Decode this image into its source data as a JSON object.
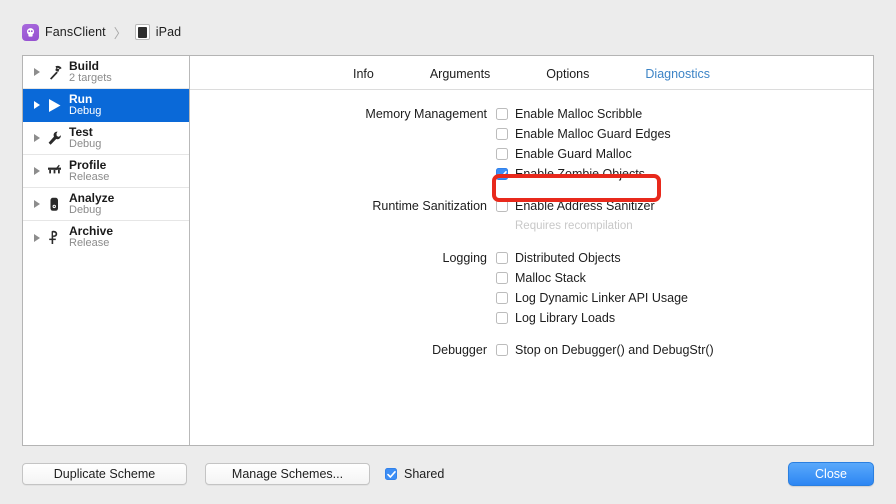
{
  "breadcrumb": {
    "app_icon": "app-icon",
    "app_name": "FansClient",
    "separator": "〉",
    "device_icon": "ipad-device-icon",
    "device_name": "iPad"
  },
  "sidebar": {
    "items": [
      {
        "title": "Build",
        "subtitle": "2 targets",
        "icon": "hammer-icon",
        "selected": false
      },
      {
        "title": "Run",
        "subtitle": "Debug",
        "icon": "play-icon",
        "selected": true
      },
      {
        "title": "Test",
        "subtitle": "Debug",
        "icon": "wrench-icon",
        "selected": false
      },
      {
        "title": "Profile",
        "subtitle": "Release",
        "icon": "gauge-icon",
        "selected": false
      },
      {
        "title": "Analyze",
        "subtitle": "Debug",
        "icon": "microscope-icon",
        "selected": false
      },
      {
        "title": "Archive",
        "subtitle": "Release",
        "icon": "archive-icon",
        "selected": false
      }
    ]
  },
  "tabs": [
    {
      "label": "Info",
      "active": false
    },
    {
      "label": "Arguments",
      "active": false
    },
    {
      "label": "Options",
      "active": false
    },
    {
      "label": "Diagnostics",
      "active": true
    }
  ],
  "diagnostics": {
    "memory_management": {
      "label": "Memory Management",
      "options": [
        {
          "label": "Enable Malloc Scribble",
          "checked": false
        },
        {
          "label": "Enable Malloc Guard Edges",
          "checked": false
        },
        {
          "label": "Enable Guard Malloc",
          "checked": false
        },
        {
          "label": "Enable Zombie Objects",
          "checked": true
        }
      ]
    },
    "runtime_sanitization": {
      "label": "Runtime Sanitization",
      "options": [
        {
          "label": "Enable Address Sanitizer",
          "checked": false
        }
      ],
      "hint": "Requires recompilation"
    },
    "logging": {
      "label": "Logging",
      "options": [
        {
          "label": "Distributed Objects",
          "checked": false
        },
        {
          "label": "Malloc Stack",
          "checked": false
        },
        {
          "label": "Log Dynamic Linker API Usage",
          "checked": false
        },
        {
          "label": "Log Library Loads",
          "checked": false
        }
      ]
    },
    "debugger": {
      "label": "Debugger",
      "options": [
        {
          "label": "Stop on Debugger() and DebugStr()",
          "checked": false
        }
      ]
    }
  },
  "footer": {
    "duplicate_scheme": "Duplicate Scheme",
    "manage_schemes": "Manage Schemes...",
    "shared_label": "Shared",
    "shared_checked": true,
    "close": "Close"
  },
  "colors": {
    "selection_blue": "#0a69d8",
    "accent_blue": "#3d8ef5",
    "tab_active": "#3d84c6",
    "highlight_red": "#e8291c",
    "app_icon_purple": "#9450cf",
    "window_bg": "#ececec"
  }
}
